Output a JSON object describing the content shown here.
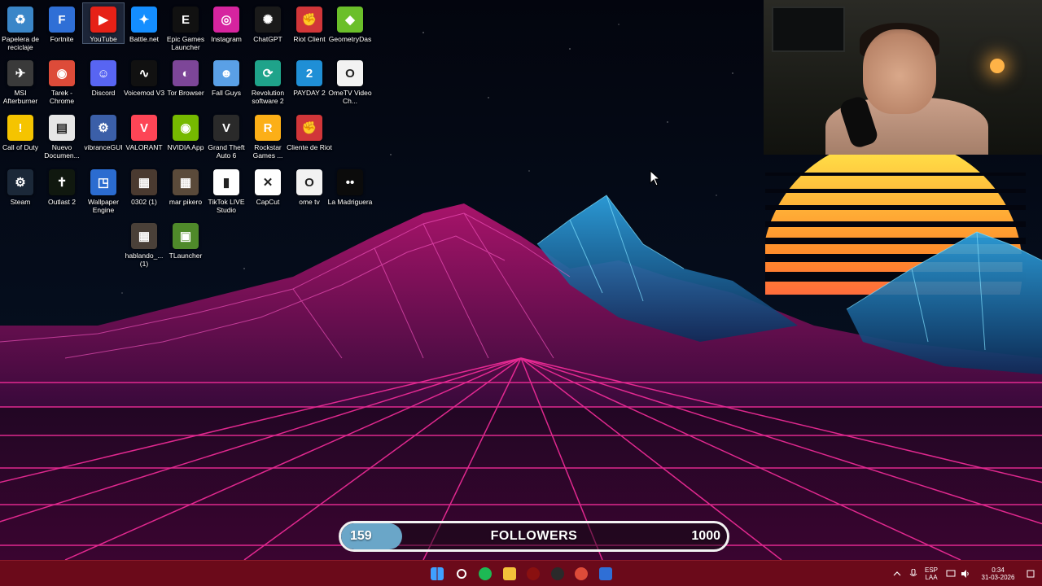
{
  "desktop": {
    "icons": [
      {
        "label": "Papelera de reciclaje",
        "icon": "recycle-bin-icon",
        "color": "#3a86c8",
        "glyph": "♻"
      },
      {
        "label": "Fortnite",
        "icon": "fortnite-icon",
        "color": "#2f6fd6",
        "glyph": "F"
      },
      {
        "label": "YouTube",
        "icon": "youtube-icon",
        "color": "#e62117",
        "glyph": "▶"
      },
      {
        "label": "Battle.net",
        "icon": "battlenet-icon",
        "color": "#148eff",
        "glyph": "✦"
      },
      {
        "label": "Epic Games Launcher",
        "icon": "epic-games-icon",
        "color": "#111111",
        "glyph": "E"
      },
      {
        "label": "Instagram",
        "icon": "instagram-icon",
        "color": "#d6249f",
        "glyph": "◎"
      },
      {
        "label": "ChatGPT",
        "icon": "chatgpt-icon",
        "color": "#1a1a1a",
        "glyph": "✺"
      },
      {
        "label": "Riot Client",
        "icon": "riot-client-icon",
        "color": "#d13639",
        "glyph": "✊"
      },
      {
        "label": "GeometryDas",
        "icon": "geometry-dash-icon",
        "color": "#6bbf2a",
        "glyph": "◆"
      },
      {
        "label": "MSI Afterburner",
        "icon": "msi-afterburner-icon",
        "color": "#3a3a3a",
        "glyph": "✈"
      },
      {
        "label": "Tarek - Chrome",
        "icon": "chrome-icon",
        "color": "#dd4b39",
        "glyph": "◉"
      },
      {
        "label": "Discord",
        "icon": "discord-icon",
        "color": "#5865f2",
        "glyph": "☺"
      },
      {
        "label": "Voicemod V3",
        "icon": "voicemod-icon",
        "color": "#111111",
        "glyph": "∿"
      },
      {
        "label": "Tor Browser",
        "icon": "tor-browser-icon",
        "color": "#7d4698",
        "glyph": "◐"
      },
      {
        "label": "Fall Guys",
        "icon": "fall-guys-icon",
        "color": "#5aa0e6",
        "glyph": "☻"
      },
      {
        "label": "Revolution software 2",
        "icon": "revolution-software-icon",
        "color": "#1fa38a",
        "glyph": "⟳"
      },
      {
        "label": "PAYDAY 2",
        "icon": "payday2-icon",
        "color": "#1f8fd6",
        "glyph": "2"
      },
      {
        "label": "OmeTV Video Ch...",
        "icon": "ometv-icon",
        "color": "#f2f2f2",
        "glyph": "O"
      },
      {
        "label": "Call of Duty",
        "icon": "warning-icon",
        "color": "#f5c400",
        "glyph": "!"
      },
      {
        "label": "Nuevo Documen...",
        "icon": "document-icon",
        "color": "#e6e6e6",
        "glyph": "▤"
      },
      {
        "label": "vibranceGUI",
        "icon": "vibrance-gui-icon",
        "color": "#3b5fa8",
        "glyph": "⚙"
      },
      {
        "label": "VALORANT",
        "icon": "valorant-icon",
        "color": "#fd4556",
        "glyph": "V"
      },
      {
        "label": "NVIDIA App",
        "icon": "nvidia-icon",
        "color": "#76b900",
        "glyph": "◉"
      },
      {
        "label": "Grand Theft Auto 6",
        "icon": "gta-icon",
        "color": "#2a2a2a",
        "glyph": "V"
      },
      {
        "label": "Rockstar Games ...",
        "icon": "rockstar-icon",
        "color": "#fcaf17",
        "glyph": "R"
      },
      {
        "label": "Cliente de Riot",
        "icon": "riot-client-icon",
        "color": "#d13639",
        "glyph": "✊"
      },
      {
        "label": "Steam",
        "icon": "steam-icon",
        "color": "#1b2838",
        "glyph": "⚙"
      },
      {
        "label": "Outlast 2",
        "icon": "outlast2-icon",
        "color": "#10180f",
        "glyph": "✝"
      },
      {
        "label": "Wallpaper Engine",
        "icon": "wallpaper-engine-icon",
        "color": "#2b6cd0",
        "glyph": "◳"
      },
      {
        "label": "0302 (1)",
        "icon": "video-thumbnail-icon",
        "color": "#4a3a30",
        "glyph": "▦"
      },
      {
        "label": "mar pikero",
        "icon": "video-thumbnail-icon",
        "color": "#5a4a3a",
        "glyph": "▦"
      },
      {
        "label": "TikTok LIVE Studio",
        "icon": "tiktok-live-icon",
        "color": "#ffffff",
        "glyph": "▮"
      },
      {
        "label": "CapCut",
        "icon": "capcut-icon",
        "color": "#ffffff",
        "glyph": "✕"
      },
      {
        "label": "ome tv",
        "icon": "ometv-icon",
        "color": "#f2f2f2",
        "glyph": "O"
      },
      {
        "label": "La Madriguera",
        "icon": "eyes-icon",
        "color": "#0b0b0b",
        "glyph": "••"
      },
      {
        "label": "hablando_... (1)",
        "icon": "video-thumbnail-icon",
        "color": "#4a4038",
        "glyph": "▦"
      },
      {
        "label": "TLauncher",
        "icon": "tlauncher-icon",
        "color": "#4f8a2a",
        "glyph": "▣"
      }
    ]
  },
  "followers": {
    "current": "159",
    "title": "FOLLOWERS",
    "goal": "1000",
    "progress_fraction": 0.159,
    "fill_color": "#6aa6c8"
  },
  "taskbar": {
    "color": "#6b0a1a",
    "apps": [
      {
        "icon": "windows-start-icon",
        "color": "#3fa0ff"
      },
      {
        "icon": "search-icon",
        "color": "#ffffff"
      },
      {
        "icon": "spotify-icon",
        "color": "#1db954"
      },
      {
        "icon": "file-explorer-icon",
        "color": "#f3c13a"
      },
      {
        "icon": "red-app-icon",
        "color": "#8a1010"
      },
      {
        "icon": "obs-icon",
        "color": "#2a2a2a"
      },
      {
        "icon": "chrome-icon",
        "color": "#dd4b39"
      },
      {
        "icon": "fortnite-icon",
        "color": "#2f6fd6"
      }
    ],
    "tray": {
      "language_top": "ESP",
      "language_bottom": "LAA",
      "time": "0:34",
      "date": "31-03-2026"
    }
  },
  "colors": {
    "wallpaper_sky": "#02040c",
    "grid_pink": "#ff2fa0",
    "grid_blue": "#2ec4ff",
    "sun_top": "#ffe84a",
    "sun_bottom": "#ff2a6d"
  }
}
